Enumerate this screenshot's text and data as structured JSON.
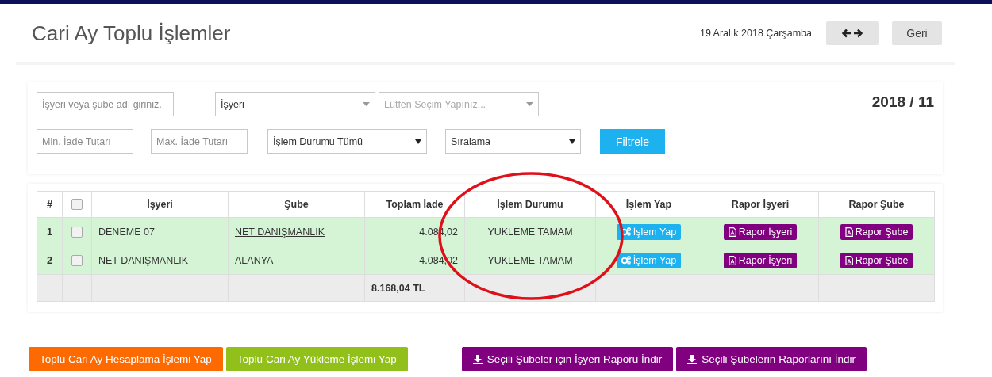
{
  "header": {
    "title": "Cari Ay Toplu İşlemler",
    "date": "19 Aralık 2018 Çarşamba",
    "back_button": "Geri"
  },
  "filters": {
    "period": "2018 / 11",
    "top_fields": [
      {
        "kind": "input",
        "placeholder": "İşyeri veya şube adı giriniz."
      },
      {
        "kind": "select",
        "value": "İşyeri"
      },
      {
        "kind": "select",
        "placeholder": "Lütfen Seçim Yapınız..."
      }
    ],
    "bottom_fields": [
      {
        "kind": "input",
        "placeholder": "Min. İade Tutarı"
      },
      {
        "kind": "input",
        "placeholder": "Max. İade Tutarı"
      },
      {
        "kind": "native-select",
        "value": "İşlem Durumu Tümü"
      },
      {
        "kind": "native-select",
        "value": "Sıralama"
      }
    ],
    "filter_button": "Filtrele"
  },
  "table": {
    "columns": [
      "#",
      "İşyeri",
      "Şube",
      "Toplam İade",
      "İşlem Durumu",
      "İşlem Yap",
      "Rapor İşyeri",
      "Rapor Şube"
    ],
    "select_all_checked": false,
    "rows": [
      {
        "no": "1",
        "checked": false,
        "isyeri": "DENEME 07",
        "sube": "NET DANIŞMANLIK",
        "toplam": "4.084,02",
        "durum": "YUKLEME TAMAM",
        "action": "İşlem Yap",
        "report_isyeri": "Rapor İşyeri",
        "report_sube": "Rapor Şube"
      },
      {
        "no": "2",
        "checked": false,
        "isyeri": "NET DANIŞMANLIK",
        "sube": "ALANYA",
        "toplam": "4.084,02",
        "durum": "YUKLEME TAMAM",
        "action": "İşlem Yap",
        "report_isyeri": "Rapor İşyeri",
        "report_sube": "Rapor Şube"
      }
    ],
    "total": "8.168,04 TL"
  },
  "actions": [
    {
      "label": "Toplu Cari Ay Hesaplama İşlemi Yap",
      "kind": "orange"
    },
    {
      "label": "Toplu Cari Ay Yükleme İşlemi Yap",
      "kind": "green"
    },
    {
      "label": "Seçili Şubeler için İşyeri Raporu İndir",
      "kind": "download"
    },
    {
      "label": "Seçili Şubelerin Raporlarını İndir",
      "kind": "download"
    }
  ]
}
